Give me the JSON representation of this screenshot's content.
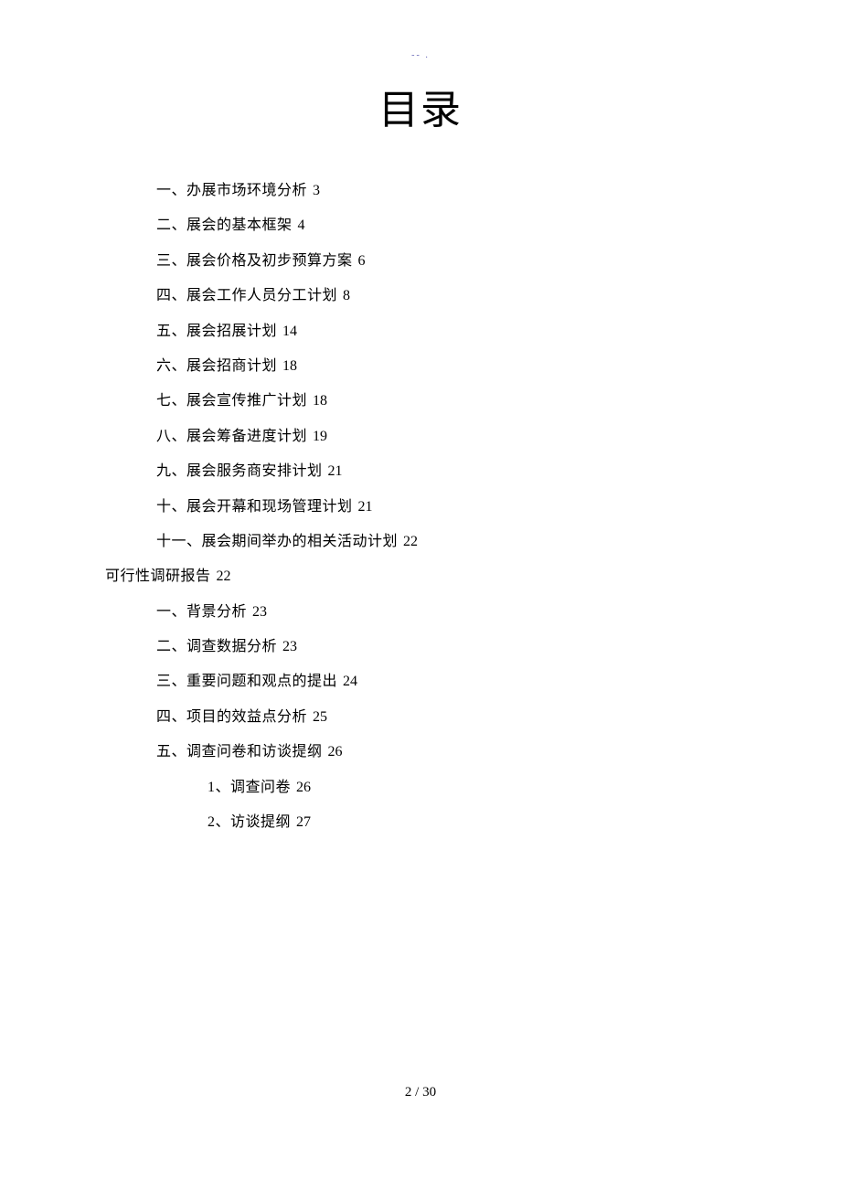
{
  "header_mark": "-- .",
  "title": "目录",
  "toc": [
    {
      "indent": 1,
      "label": "一、办展市场环境分析",
      "page": "3"
    },
    {
      "indent": 1,
      "label": "二、展会的基本框架",
      "page": "4"
    },
    {
      "indent": 1,
      "label": "三、展会价格及初步预算方案",
      "page": "6"
    },
    {
      "indent": 1,
      "label": "四、展会工作人员分工计划",
      "page": "8"
    },
    {
      "indent": 1,
      "label": "五、展会招展计划",
      "page": "14"
    },
    {
      "indent": 1,
      "label": "六、展会招商计划",
      "page": "18"
    },
    {
      "indent": 1,
      "label": "七、展会宣传推广计划",
      "page": "18"
    },
    {
      "indent": 1,
      "label": "八、展会筹备进度计划",
      "page": "19"
    },
    {
      "indent": 1,
      "label": "九、展会服务商安排计划",
      "page": "21"
    },
    {
      "indent": 1,
      "label": "十、展会开幕和现场管理计划",
      "page": "21"
    },
    {
      "indent": 1,
      "label": "十一、展会期间举办的相关活动计划",
      "page": "22"
    },
    {
      "indent": 0,
      "label": "可行性调研报告",
      "page": "22"
    },
    {
      "indent": 1,
      "label": "一、背景分析",
      "page": "23"
    },
    {
      "indent": 1,
      "label": "二、调查数据分析",
      "page": "23"
    },
    {
      "indent": 1,
      "label": "三、重要问题和观点的提出",
      "page": "24"
    },
    {
      "indent": 1,
      "label": "四、项目的效益点分析",
      "page": "25"
    },
    {
      "indent": 1,
      "label": "五、调查问卷和访谈提纲",
      "page": "26"
    },
    {
      "indent": 2,
      "label": "1、调查问卷",
      "page": "26"
    },
    {
      "indent": 2,
      "label": "2、访谈提纲",
      "page": "27"
    }
  ],
  "footer": {
    "current": "2",
    "separator": " / ",
    "total": "30"
  }
}
